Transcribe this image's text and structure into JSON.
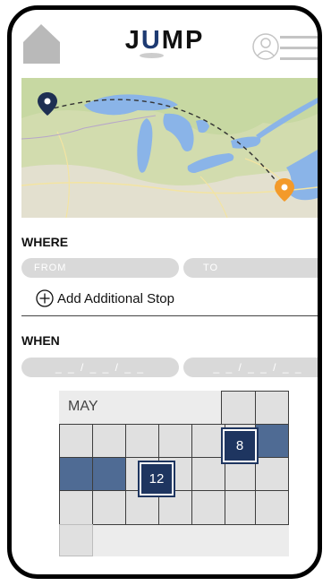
{
  "app": {
    "logo_left": "J",
    "logo_mid": "U",
    "logo_right": "MP"
  },
  "icons": {
    "home": "home-icon",
    "profile": "profile-icon",
    "menu": "hamburger-menu-icon",
    "add": "plus-circle-icon",
    "origin_pin": "map-pin-icon",
    "destination_pin": "map-pin-icon"
  },
  "colors": {
    "brand": "#1d3a72",
    "origin_pin": "#1e2f52",
    "destination_pin": "#f39a2a",
    "selected_day": "#1e3560",
    "range": "#4f6b94"
  },
  "where": {
    "label": "WHERE",
    "from_placeholder": "FROM",
    "to_placeholder": "TO"
  },
  "add_stop": {
    "label": "Add Additional Stop"
  },
  "when": {
    "label": "WHEN",
    "start_placeholder": "_ _ / _ _ / _ _",
    "end_placeholder": "_ _ / _ _ / _ _"
  },
  "calendar": {
    "month": "MAY",
    "start_day": "8",
    "end_day": "12"
  }
}
